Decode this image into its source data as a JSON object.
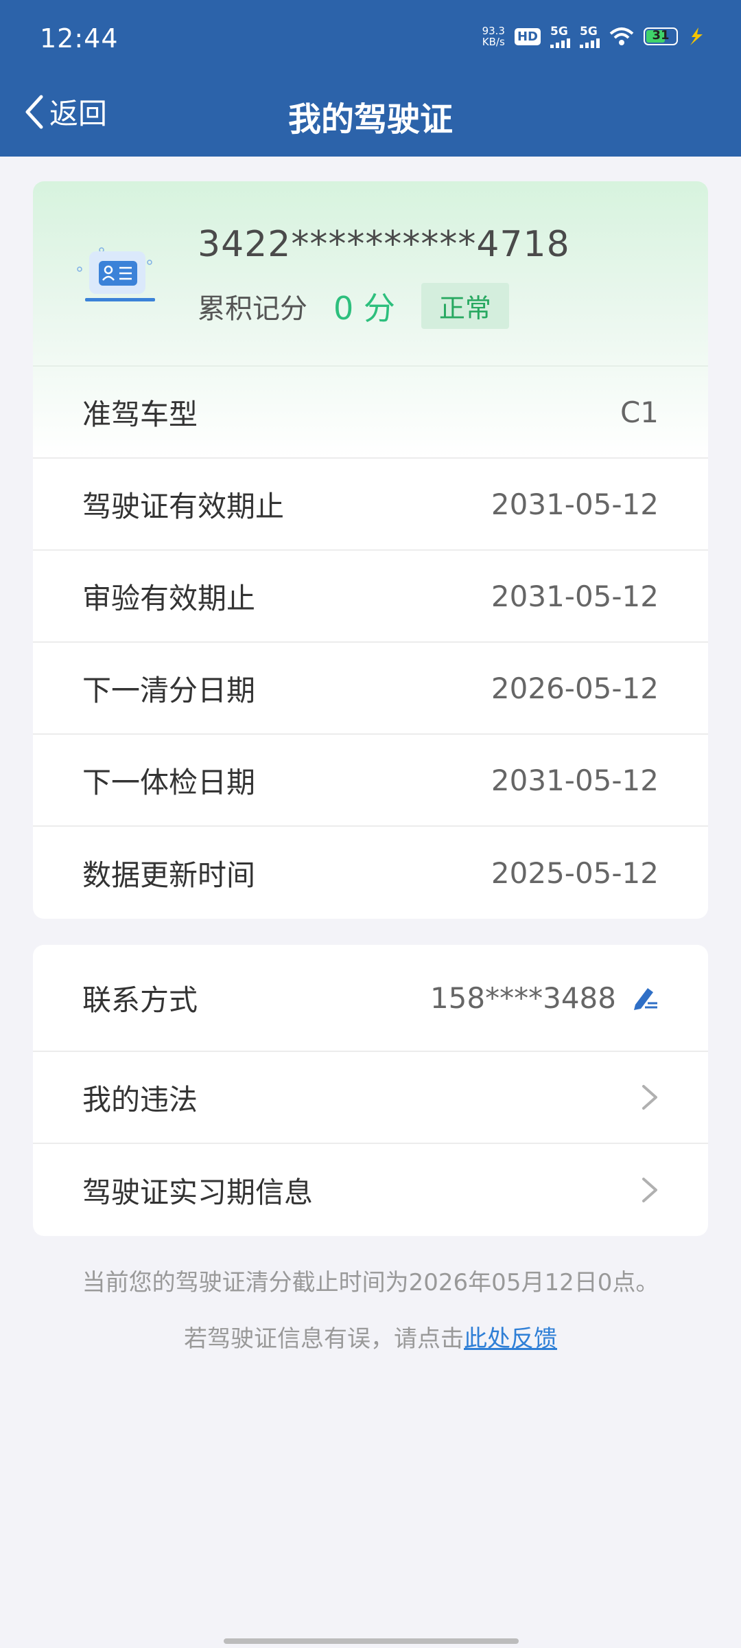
{
  "status_bar": {
    "time": "12:44",
    "net_speed_value": "93.3",
    "net_speed_unit": "KB/s",
    "hd": "HD",
    "sim1": "5G",
    "sim2": "5G",
    "battery": "31"
  },
  "nav": {
    "back_label": "返回",
    "title": "我的驾驶证"
  },
  "license": {
    "id_number": "3422**********4718",
    "points_label": "累积记分",
    "points_value": "0 分",
    "status_badge": "正常"
  },
  "details": [
    {
      "label": "准驾车型",
      "value": "C1"
    },
    {
      "label": "驾驶证有效期止",
      "value": "2031-05-12"
    },
    {
      "label": "审验有效期止",
      "value": "2031-05-12"
    },
    {
      "label": "下一清分日期",
      "value": "2026-05-12"
    },
    {
      "label": "下一体检日期",
      "value": "2031-05-12"
    },
    {
      "label": "数据更新时间",
      "value": "2025-05-12"
    }
  ],
  "actions": {
    "contact_label": "联系方式",
    "contact_value": "158****3488",
    "violations_label": "我的违法",
    "probation_label": "驾驶证实习期信息"
  },
  "notes": {
    "clear_notice": "当前您的驾驶证清分截止时间为2026年05月12日0点。",
    "feedback_prefix": "若驾驶证信息有误，请点击",
    "feedback_link": "此处反馈"
  },
  "colors": {
    "header": "#2c63aa",
    "accent_green": "#2dbf7d",
    "link": "#2f7fd6"
  }
}
